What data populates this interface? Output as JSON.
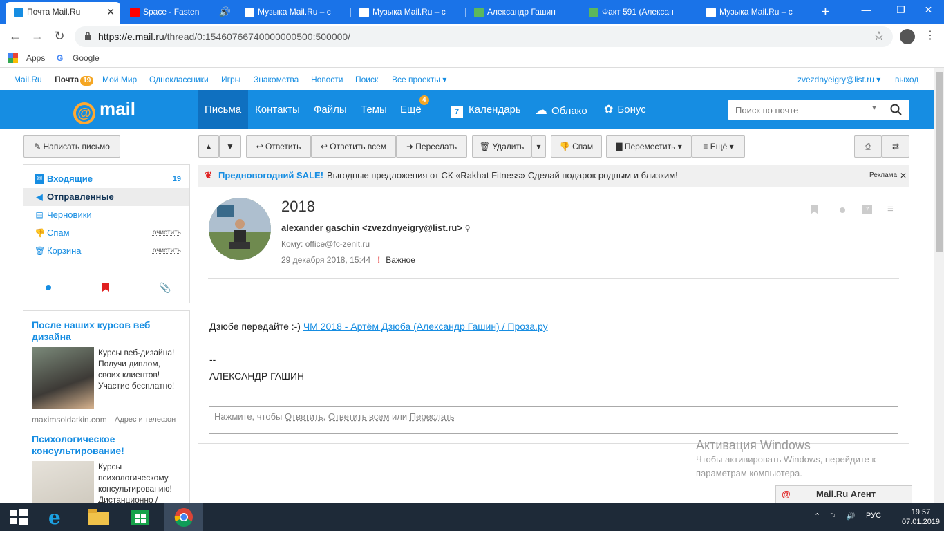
{
  "browser": {
    "tabs": [
      {
        "title": "Почта Mail.Ru",
        "active": true
      },
      {
        "title": "Space - Fasten"
      },
      {
        "title": "Музыка Mail.Ru – с"
      },
      {
        "title": "Музыка Mail.Ru – с"
      },
      {
        "title": "Александр Гашин"
      },
      {
        "title": "Факт 591 (Алексан"
      },
      {
        "title": "Музыка Mail.Ru – с"
      }
    ],
    "new_tab": "+",
    "url_host": "https://e.mail.ru",
    "url_path": "/thread/0:15460766740000000500:500000/",
    "bookmarks": {
      "apps": "Apps",
      "google": "Google"
    }
  },
  "portal": {
    "links": [
      "Mail.Ru",
      "Почта",
      "Мой Мир",
      "Одноклассники",
      "Игры",
      "Знакомства",
      "Новости",
      "Поиск",
      "Все проекты ▾"
    ],
    "mail_badge": "19",
    "user": "zvezdnyeigry@list.ru ▾",
    "logout": "выход"
  },
  "header": {
    "logo": "mail",
    "nav": [
      "Письма",
      "Контакты",
      "Файлы",
      "Темы",
      "Ещё"
    ],
    "more_badge": "4",
    "nav2": [
      "Календарь",
      "Облако",
      "Бонус"
    ],
    "calendar_day": "7",
    "search_placeholder": "Поиск по почте"
  },
  "toolbar": {
    "compose": "Написать письмо",
    "reply": "Ответить",
    "reply_all": "Ответить всем",
    "forward": "Переслать",
    "delete": "Удалить",
    "spam": "Спам",
    "move": "Переместить ▾",
    "more": "≡ Ещё ▾"
  },
  "folders": [
    {
      "label": "Входящие",
      "count": "19"
    },
    {
      "label": "Отправленные"
    },
    {
      "label": "Черновики"
    },
    {
      "label": "Спам",
      "action": "очистить"
    },
    {
      "label": "Корзина",
      "action": "очистить"
    }
  ],
  "ads": [
    {
      "title": "После наших курсов веб дизайна",
      "text": "Курсы веб-дизайна! Получи диплом, своих клиентов! Участие бесплатно!",
      "domain": "maximsoldatkin.com",
      "extra": "Адрес и телефон"
    },
    {
      "title": "Психологическое консультирование!",
      "text": "Курсы психологическому консультированию! Дистанционно /"
    }
  ],
  "banner": {
    "sale": "Предновогодний SALE!",
    "text": "Выгодные предложения от СК «Rakhat Fitness» Сделай подарок родным и близким!",
    "label": "Реклама"
  },
  "message": {
    "subject": "2018",
    "from": "alexander gaschin <zvezdnyeigry@list.ru>",
    "to": "Кому: office@fc-zenit.ru",
    "date": "29 декабря 2018, 15:44",
    "important_mark": "!",
    "important": "Важное",
    "body_prefix": "Дзюбе передайте :-) ",
    "body_link": "ЧМ 2018 - Артём Дзюба (Александр Гашин) / Проза.ру",
    "sig_dash": "--",
    "signature": "АЛЕКСАНДР ГАШИН"
  },
  "reply_box": {
    "prefix": "Нажмите, чтобы ",
    "reply": "Ответить",
    "sep": ", ",
    "reply_all": "Ответить всем",
    "or": " или ",
    "forward": "Переслать"
  },
  "activation": {
    "title": "Активация Windows",
    "line1": "Чтобы активировать Windows, перейдите к",
    "line2": "параметрам компьютера."
  },
  "agent": "Mail.Ru Агент",
  "taskbar": {
    "lang": "РУС",
    "time": "19:57",
    "date": "07.01.2019"
  }
}
